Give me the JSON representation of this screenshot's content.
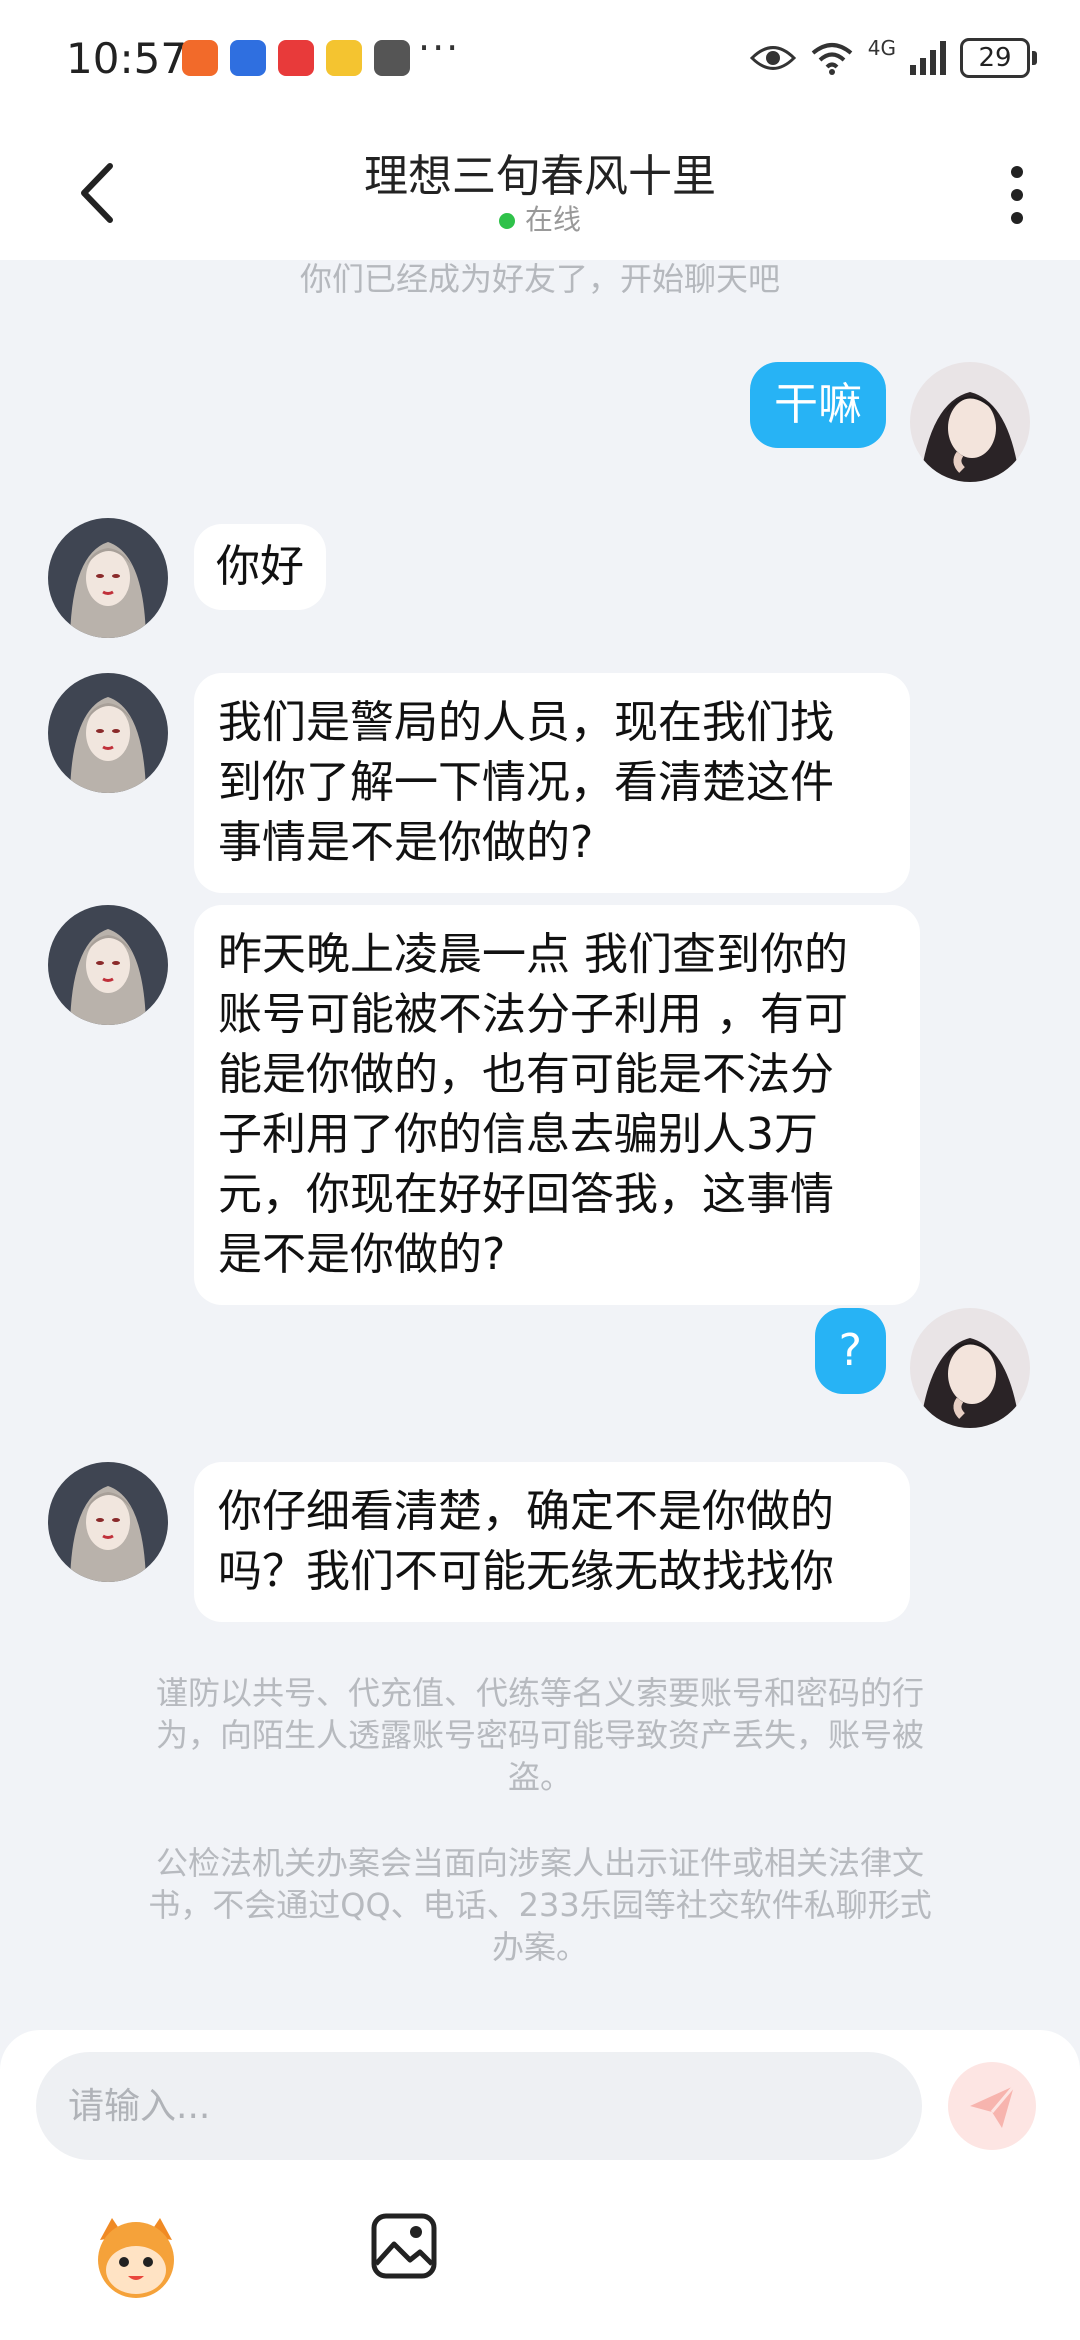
{
  "status_bar": {
    "time": "10:57",
    "more": "···",
    "network": "4G",
    "battery": "29"
  },
  "header": {
    "title": "理想三旬春风十里",
    "status": "在线"
  },
  "chat": {
    "system_message": "你们已经成为好友了，开始聊天吧",
    "messages": [
      {
        "side": "out",
        "text": "干嘛"
      },
      {
        "side": "in",
        "text": "你好"
      },
      {
        "side": "in",
        "lines": [
          "我们是警局的人员，现在我们找",
          "到你了解一下情况，看清楚这件",
          "事情是不是你做的?"
        ]
      },
      {
        "side": "in",
        "lines": [
          "昨天晚上凌晨一点 我们查到你的",
          "账号可能被不法分子利用 ，有可",
          "能是你做的，也有可能是不法分",
          "子利用了你的信息去骗别人3万",
          "元，你现在好好回答我，这事情",
          "是不是你做的?"
        ]
      },
      {
        "side": "out",
        "text": "?"
      },
      {
        "side": "in",
        "lines": [
          "你仔细看清楚，确定不是你做的",
          "吗？我们不可能无缘无故找找你"
        ]
      }
    ],
    "notices": [
      [
        "谨防以共号、代充值、代练等名义索要账号和密码的行",
        "为，向陌生人透露账号密码可能导致资产丢失，账号被",
        "盗。"
      ],
      [
        "公检法机关办案会当面向涉案人出示证件或相关法律文",
        "书，不会通过QQ、电话、233乐园等社交软件私聊形式",
        "办案。"
      ]
    ]
  },
  "input": {
    "placeholder": "请输入..."
  },
  "colors": {
    "out_bubble": "#27b3f5",
    "in_bubble": "#ffffff",
    "background": "#f1f3f7",
    "online_dot": "#2fc24a"
  }
}
